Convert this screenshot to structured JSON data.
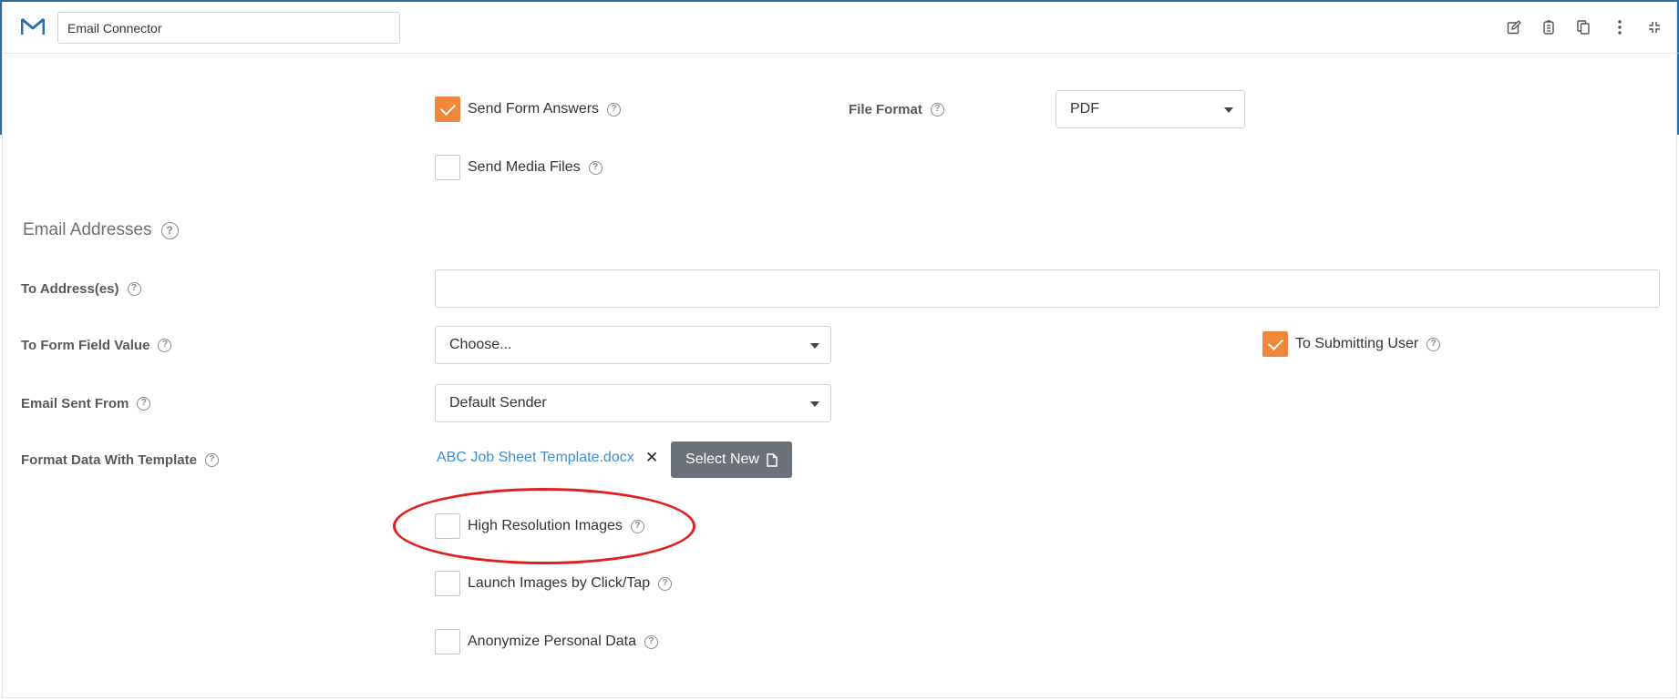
{
  "header": {
    "title_value": "Email Connector",
    "icons": [
      "edit-icon",
      "clipboard-icon",
      "copy-icon",
      "more-vert-icon",
      "collapse-icon"
    ]
  },
  "options": {
    "send_form_answers": {
      "label": "Send Form Answers",
      "checked": true
    },
    "send_media_files": {
      "label": "Send Media Files",
      "checked": false
    },
    "file_format": {
      "label": "File Format",
      "value": "PDF"
    }
  },
  "email": {
    "section_title": "Email Addresses",
    "to_addresses": {
      "label": "To Address(es)",
      "value": ""
    },
    "to_form_field": {
      "label": "To Form Field Value",
      "value": "Choose..."
    },
    "to_submitting_user": {
      "label": "To Submitting User",
      "checked": true
    },
    "sent_from": {
      "label": "Email Sent From",
      "value": "Default Sender"
    },
    "template": {
      "label": "Format Data With Template",
      "file": "ABC Job Sheet Template.docx",
      "remove": "✕",
      "select_new": "Select New"
    }
  },
  "images": {
    "high_resolution": {
      "label": "High Resolution Images",
      "checked": false
    },
    "launch_by_click": {
      "label": "Launch Images by Click/Tap",
      "checked": false
    },
    "anonymize": {
      "label": "Anonymize Personal Data",
      "checked": false
    }
  },
  "help_glyph": "?",
  "colors": {
    "accent": "#f0883b",
    "link": "#3a8fd6",
    "button": "#6a7178",
    "annotation": "#e02020"
  }
}
